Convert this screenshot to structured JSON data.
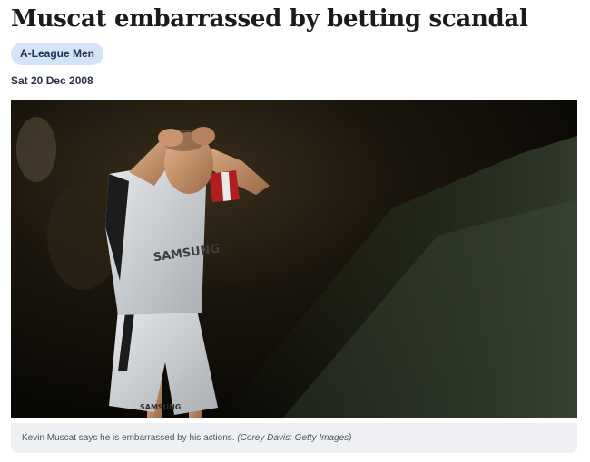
{
  "article": {
    "title": "Muscat embarrassed by betting scandal",
    "tag": "A-League Men",
    "date": "Sat 20 Dec 2008"
  },
  "photo": {
    "caption": "Kevin Muscat says he is embarrassed by his actions.",
    "credit": "(Corey Davis: Getty Images)",
    "shirt_text": "SAMSUNG",
    "shorts_text": "SAMSUNG"
  }
}
